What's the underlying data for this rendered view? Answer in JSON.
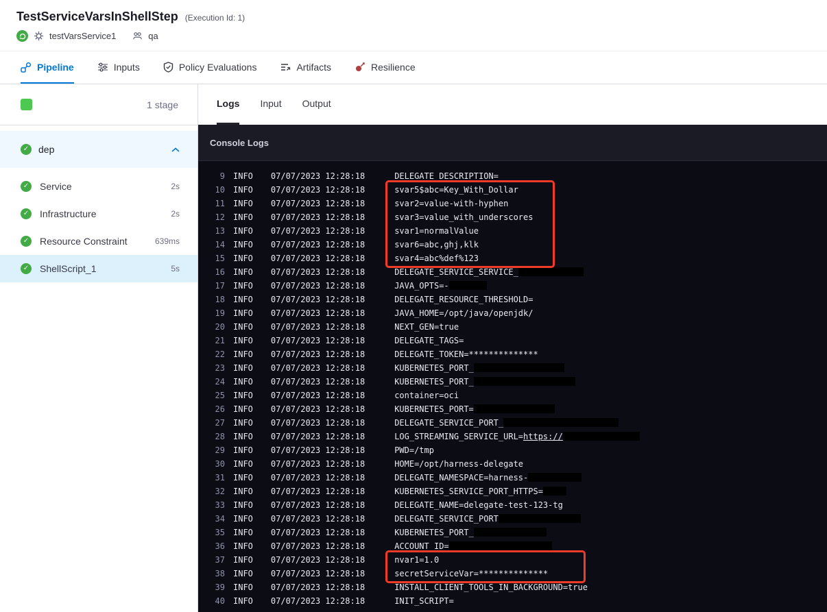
{
  "colors": {
    "brand_blue": "#0278d5",
    "success_green": "#42ab45",
    "highlight_red": "#f23a28"
  },
  "header": {
    "title": "TestServiceVarsInShellStep",
    "execution_id": "(Execution Id: 1)",
    "service_name": "testVarsService1",
    "environment": "qa"
  },
  "nav_tabs": [
    {
      "label": "Pipeline",
      "active": true
    },
    {
      "label": "Inputs",
      "active": false
    },
    {
      "label": "Policy Evaluations",
      "active": false
    },
    {
      "label": "Artifacts",
      "active": false
    },
    {
      "label": "Resilience",
      "active": false
    }
  ],
  "sidebar": {
    "stage_count": "1 stage",
    "stage": {
      "name": "dep",
      "expanded": true
    },
    "steps": [
      {
        "label": "Service",
        "duration": "2s",
        "selected": false
      },
      {
        "label": "Infrastructure",
        "duration": "2s",
        "selected": false
      },
      {
        "label": "Resource Constraint",
        "duration": "639ms",
        "selected": false
      },
      {
        "label": "ShellScript_1",
        "duration": "5s",
        "selected": true
      }
    ]
  },
  "console": {
    "tabs": [
      {
        "label": "Logs",
        "active": true
      },
      {
        "label": "Input",
        "active": false
      },
      {
        "label": "Output",
        "active": false
      }
    ],
    "title": "Console Logs",
    "highlights": [
      {
        "from_line": 10,
        "to_line": 15
      },
      {
        "from_line": 37,
        "to_line": 38
      }
    ],
    "lines": [
      {
        "num": 9,
        "level": "INFO",
        "timestamp": "07/07/2023 12:28:18",
        "parts": [
          {
            "t": "DELEGATE_DESCRIPTION="
          }
        ]
      },
      {
        "num": 10,
        "level": "INFO",
        "timestamp": "07/07/2023 12:28:18",
        "parts": [
          {
            "t": "svar5$abc=Key_With_Dollar"
          }
        ]
      },
      {
        "num": 11,
        "level": "INFO",
        "timestamp": "07/07/2023 12:28:18",
        "parts": [
          {
            "t": "svar2=value-with-hyphen"
          }
        ]
      },
      {
        "num": 12,
        "level": "INFO",
        "timestamp": "07/07/2023 12:28:18",
        "parts": [
          {
            "t": "svar3=value_with_underscores"
          }
        ]
      },
      {
        "num": 13,
        "level": "INFO",
        "timestamp": "07/07/2023 12:28:18",
        "parts": [
          {
            "t": "svar1=normalValue"
          }
        ]
      },
      {
        "num": 14,
        "level": "INFO",
        "timestamp": "07/07/2023 12:28:18",
        "parts": [
          {
            "t": "svar6=abc,ghj,klk"
          }
        ]
      },
      {
        "num": 15,
        "level": "INFO",
        "timestamp": "07/07/2023 12:28:18",
        "parts": [
          {
            "t": "svar4=abc%def%123"
          }
        ]
      },
      {
        "num": 16,
        "level": "INFO",
        "timestamp": "07/07/2023 12:28:18",
        "parts": [
          {
            "t": "DELEGATE_SERVICE_SERVICE_"
          },
          {
            "redact_w": 95
          }
        ]
      },
      {
        "num": 17,
        "level": "INFO",
        "timestamp": "07/07/2023 12:28:18",
        "parts": [
          {
            "t": "JAVA_OPTS=-"
          },
          {
            "redact_w": 55
          }
        ]
      },
      {
        "num": 18,
        "level": "INFO",
        "timestamp": "07/07/2023 12:28:18",
        "parts": [
          {
            "t": "DELEGATE_RESOURCE_THRESHOLD="
          }
        ]
      },
      {
        "num": 19,
        "level": "INFO",
        "timestamp": "07/07/2023 12:28:18",
        "parts": [
          {
            "t": "JAVA_HOME=/opt/java/openjdk/"
          }
        ]
      },
      {
        "num": 20,
        "level": "INFO",
        "timestamp": "07/07/2023 12:28:18",
        "parts": [
          {
            "t": "NEXT_GEN=true"
          }
        ]
      },
      {
        "num": 21,
        "level": "INFO",
        "timestamp": "07/07/2023 12:28:18",
        "parts": [
          {
            "t": "DELEGATE_TAGS="
          }
        ]
      },
      {
        "num": 22,
        "level": "INFO",
        "timestamp": "07/07/2023 12:28:18",
        "parts": [
          {
            "t": "DELEGATE_TOKEN=**************"
          }
        ]
      },
      {
        "num": 23,
        "level": "INFO",
        "timestamp": "07/07/2023 12:28:18",
        "parts": [
          {
            "t": "KUBERNETES_PORT_"
          },
          {
            "redact_w": 132
          }
        ]
      },
      {
        "num": 24,
        "level": "INFO",
        "timestamp": "07/07/2023 12:28:18",
        "parts": [
          {
            "t": "KUBERNETES_PORT_"
          },
          {
            "redact_w": 148
          }
        ]
      },
      {
        "num": 25,
        "level": "INFO",
        "timestamp": "07/07/2023 12:28:18",
        "parts": [
          {
            "t": "container=oci"
          }
        ]
      },
      {
        "num": 26,
        "level": "INFO",
        "timestamp": "07/07/2023 12:28:18",
        "parts": [
          {
            "t": "KUBERNETES_PORT="
          },
          {
            "redact_w": 118
          }
        ]
      },
      {
        "num": 27,
        "level": "INFO",
        "timestamp": "07/07/2023 12:28:18",
        "parts": [
          {
            "t": "DELEGATE_SERVICE_PORT_"
          },
          {
            "redact_w": 168
          }
        ]
      },
      {
        "num": 28,
        "level": "INFO",
        "timestamp": "07/07/2023 12:28:18",
        "parts": [
          {
            "t": "LOG_STREAMING_SERVICE_URL="
          },
          {
            "t": "https://",
            "link": true
          },
          {
            "redact_w": 112
          }
        ]
      },
      {
        "num": 29,
        "level": "INFO",
        "timestamp": "07/07/2023 12:28:18",
        "parts": [
          {
            "t": "PWD=/tmp"
          }
        ]
      },
      {
        "num": 30,
        "level": "INFO",
        "timestamp": "07/07/2023 12:28:18",
        "parts": [
          {
            "t": "HOME=/opt/harness-delegate"
          }
        ]
      },
      {
        "num": 31,
        "level": "INFO",
        "timestamp": "07/07/2023 12:28:18",
        "parts": [
          {
            "t": "DELEGATE_NAMESPACE=harness-"
          },
          {
            "redact_w": 78
          }
        ]
      },
      {
        "num": 32,
        "level": "INFO",
        "timestamp": "07/07/2023 12:28:18",
        "parts": [
          {
            "t": "KUBERNETES_SERVICE_PORT_HTTPS="
          },
          {
            "redact_w": 34
          }
        ]
      },
      {
        "num": 33,
        "level": "INFO",
        "timestamp": "07/07/2023 12:28:18",
        "parts": [
          {
            "t": "DELEGATE_NAME=delegate-test-123-tg"
          }
        ]
      },
      {
        "num": 34,
        "level": "INFO",
        "timestamp": "07/07/2023 12:28:18",
        "parts": [
          {
            "t": "DELEGATE_SERVICE_PORT"
          },
          {
            "redact_w": 120
          }
        ]
      },
      {
        "num": 35,
        "level": "INFO",
        "timestamp": "07/07/2023 12:28:18",
        "parts": [
          {
            "t": "KUBERNETES_PORT_"
          },
          {
            "redact_w": 106
          }
        ]
      },
      {
        "num": 36,
        "level": "INFO",
        "timestamp": "07/07/2023 12:28:18",
        "parts": [
          {
            "t": "ACCOUNT_ID="
          },
          {
            "redact_w": 150
          }
        ]
      },
      {
        "num": 37,
        "level": "INFO",
        "timestamp": "07/07/2023 12:28:18",
        "parts": [
          {
            "t": "nvar1=1.0"
          }
        ]
      },
      {
        "num": 38,
        "level": "INFO",
        "timestamp": "07/07/2023 12:28:18",
        "parts": [
          {
            "t": "secretServiceVar=**************"
          }
        ]
      },
      {
        "num": 39,
        "level": "INFO",
        "timestamp": "07/07/2023 12:28:18",
        "parts": [
          {
            "t": "INSTALL_CLIENT_TOOLS_IN_BACKGROUND=true"
          }
        ]
      },
      {
        "num": 40,
        "level": "INFO",
        "timestamp": "07/07/2023 12:28:18",
        "parts": [
          {
            "t": "INIT_SCRIPT="
          }
        ]
      }
    ]
  }
}
